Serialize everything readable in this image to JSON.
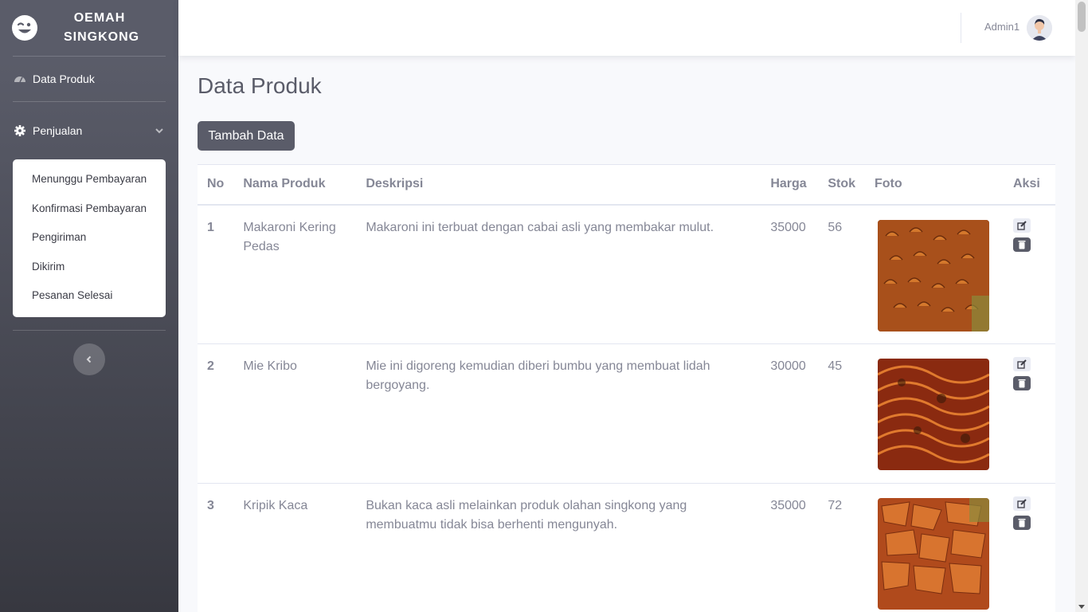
{
  "sidebar": {
    "brand_line1": "OEMAH",
    "brand_line2": "SINGKONG",
    "nav_data_produk": "Data Produk",
    "nav_penjualan": "Penjualan",
    "submenu": [
      "Menunggu Pembayaran",
      "Konfirmasi Pembayaran",
      "Pengiriman",
      "Dikirim",
      "Pesanan Selesai"
    ]
  },
  "topbar": {
    "username": "Admin1"
  },
  "main": {
    "title": "Data Produk",
    "add_button": "Tambah Data",
    "columns": [
      "No",
      "Nama Produk",
      "Deskripsi",
      "Harga",
      "Stok",
      "Foto",
      "Aksi"
    ],
    "rows": [
      {
        "no": "1",
        "nama": "Makaroni Kering Pedas",
        "deskripsi": "Makaroni ini terbuat dengan cabai asli yang membakar mulut.",
        "harga": "35000",
        "stok": "56",
        "photo_icon": "makaroni-photo"
      },
      {
        "no": "2",
        "nama": "Mie Kribo",
        "deskripsi": "Mie ini digoreng kemudian diberi bumbu yang membuat lidah bergoyang.",
        "harga": "30000",
        "stok": "45",
        "photo_icon": "mie-photo"
      },
      {
        "no": "3",
        "nama": "Kripik Kaca",
        "deskripsi": "Bukan kaca asli melainkan produk olahan singkong yang membuatmu tidak bisa berhenti mengunyah.",
        "harga": "35000",
        "stok": "72",
        "photo_icon": "kripik-photo"
      }
    ]
  },
  "colors": {
    "sidebar": "#5a5c69",
    "button": "#5a5c69",
    "text": "#858796",
    "title": "#5a5c69"
  }
}
